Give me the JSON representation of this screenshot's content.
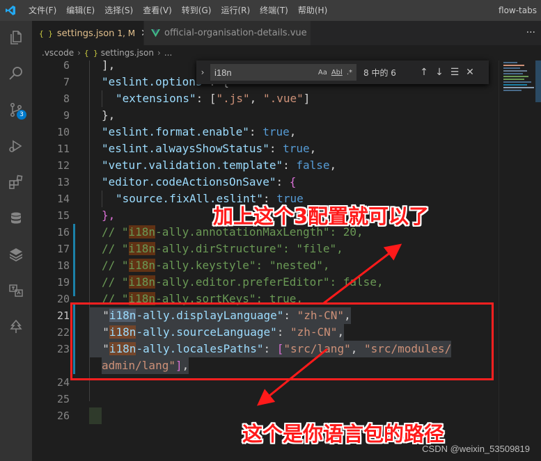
{
  "window": {
    "title": "flow-tabs",
    "menu": [
      "文件(F)",
      "编辑(E)",
      "选择(S)",
      "查看(V)",
      "转到(G)",
      "运行(R)",
      "终端(T)",
      "帮助(H)"
    ]
  },
  "activity_bar": {
    "items": [
      "explorer-icon",
      "search-icon",
      "source-control-icon",
      "run-debug-icon",
      "extensions-icon",
      "database-icon",
      "layers-icon",
      "translate-icon",
      "tree-icon"
    ],
    "source_control_badge": "3"
  },
  "tabs": [
    {
      "icon": "{ }",
      "label": "settings.json",
      "extra": "1, M",
      "active": true
    },
    {
      "icon": "vue-icon",
      "label": "official-organisation-details.vue",
      "active": false
    }
  ],
  "tab_more": "···",
  "breadcrumb": [
    ".vscode",
    "settings.json",
    "..."
  ],
  "breadcrumb_json_icon": "{ }",
  "find_widget": {
    "query": "i18n",
    "opt_case": "Aa",
    "opt_word": "Abl",
    "opt_regex": ".*",
    "count": "8 中的 6",
    "toggle": "›",
    "prev": "↑",
    "next": "↓",
    "selection": "☰",
    "close": "✕"
  },
  "line_numbers": [
    "6",
    "7",
    "8",
    "9",
    "10",
    "11",
    "12",
    "13",
    "14",
    "15",
    "16",
    "17",
    "18",
    "19",
    "20",
    "21",
    "22",
    "23",
    "",
    "24",
    "25",
    "26"
  ],
  "code": {
    "l6": "],",
    "l7_key": "\"eslint.options\"",
    "l7_rest": ": {",
    "l8_key": "\"extensions\"",
    "l8_rest": ": [",
    "l8_s1": "\".js\"",
    "l8_comma": ", ",
    "l8_s2": "\".vue\"",
    "l8_end": "]",
    "l9": "},",
    "l10_key": "\"eslint.format.enable\"",
    "l10_val": "true",
    "l11_key": "\"eslint.alwaysShowStatus\"",
    "l11_val": "true",
    "l12_key": "\"vetur.validation.template\"",
    "l12_val": "false",
    "l13_key": "\"editor.codeActionsOnSave\"",
    "l14_key": "\"source.fixAll.eslint\"",
    "l14_val": "true",
    "l15": "},",
    "l16_a": "// \"",
    "l16_b": "i18n",
    "l16_c": "-ally.annotationMaxLength\": 20,",
    "l17_c": "-ally.dirStructure\": \"file\",",
    "l18_c": "-ally.keystyle\": \"nested\",",
    "l19_c": "-ally.editor.preferEditor\": false,",
    "l20_c": "-ally.sortKeys\": true,",
    "l21_b": "i18n",
    "l21_c": "-ally.displayLanguage\"",
    "l21_v": "\"zh-CN\"",
    "l22_b": "i18n",
    "l22_c": "-ally.sourceLanguage\"",
    "l22_v": "\"zh-CN\"",
    "l23_b": "i18n",
    "l23_c": "-ally.localesPaths\"",
    "l23_s1": "\"src/lang\"",
    "l23_s2": "\"src/modules/",
    "l23b_s": "admin/lang\"",
    "l25": "}"
  },
  "annotations": {
    "top": "加上这个3配置就可以了",
    "bottom": "这个是你语言包的路径",
    "watermark": "CSDN @weixin_53509819"
  },
  "colors": {
    "accent": "#007acc",
    "annotation": "#ff1a1a",
    "string": "#ce9178",
    "key": "#9cdcfe",
    "bool": "#569cd6",
    "comment": "#6a9955"
  }
}
